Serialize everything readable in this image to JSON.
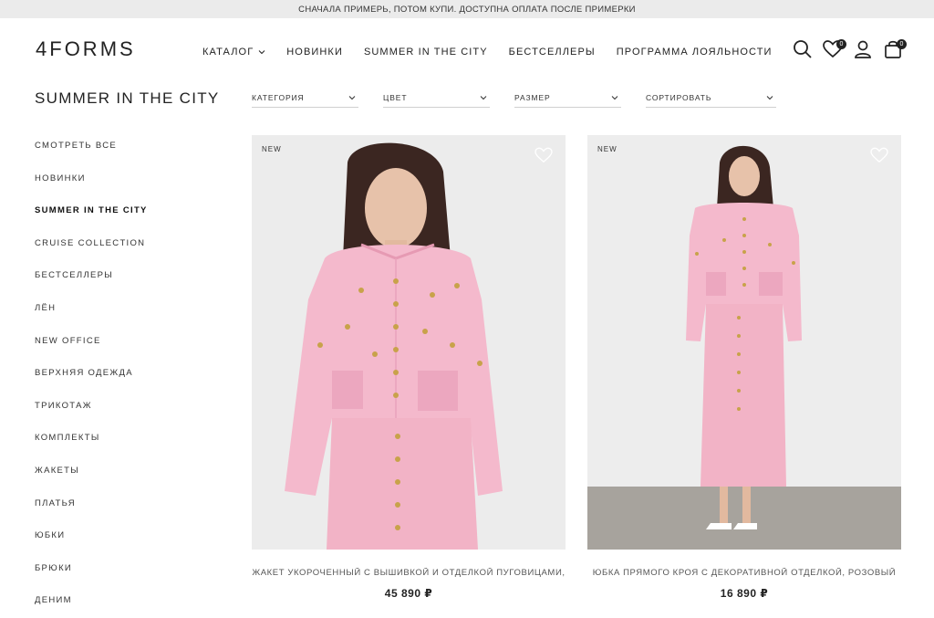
{
  "promo_bar": {
    "text": "СНАЧАЛА ПРИМЕРЬ, ПОТОМ КУПИ. ДОСТУПНА ОПЛАТА ПОСЛЕ ПРИМЕРКИ"
  },
  "header": {
    "logo": {
      "digit": "4",
      "word": "FORMS"
    },
    "nav": [
      {
        "label": "КАТАЛОГ",
        "has_dropdown": true
      },
      {
        "label": "НОВИНКИ"
      },
      {
        "label": "SUMMER IN THE CITY"
      },
      {
        "label": "БЕСТСЕЛЛЕРЫ"
      },
      {
        "label": "ПРОГРАММА ЛОЯЛЬНОСТИ"
      }
    ],
    "icons": {
      "search": "search-icon",
      "favorites": "heart-icon",
      "favorites_count": "0",
      "account": "user-icon",
      "cart": "bag-icon",
      "cart_count": "0"
    }
  },
  "page": {
    "title": "SUMMER IN THE CITY"
  },
  "filters": [
    {
      "label": "КАТЕГОРИЯ"
    },
    {
      "label": "ЦВЕТ"
    },
    {
      "label": "РАЗМЕР"
    },
    {
      "label": "СОРТИРОВАТЬ"
    }
  ],
  "sidebar": {
    "items": [
      {
        "label": "СМОТРЕТЬ ВСЕ"
      },
      {
        "label": "НОВИНКИ"
      },
      {
        "label": "SUMMER IN THE CITY",
        "active": true
      },
      {
        "label": "CRUISE COLLECTION"
      },
      {
        "label": "БЕСТСЕЛЛЕРЫ"
      },
      {
        "label": "ЛЁН"
      },
      {
        "label": "NEW OFFICE"
      },
      {
        "label": "ВЕРХНЯЯ ОДЕЖДА"
      },
      {
        "label": "ТРИКОТАЖ"
      },
      {
        "label": "КОМПЛЕКТЫ"
      },
      {
        "label": "ЖАКЕТЫ"
      },
      {
        "label": "ПЛАТЬЯ"
      },
      {
        "label": "ЮБКИ"
      },
      {
        "label": "БРЮКИ"
      },
      {
        "label": "ДЕНИМ"
      }
    ]
  },
  "products": [
    {
      "badge": "NEW",
      "name": "ЖАКЕТ УКОРОЧЕННЫЙ С ВЫШИВКОЙ И ОТДЕЛКОЙ ПУГОВИЦАМИ,",
      "price": "45 890 ₽"
    },
    {
      "badge": "NEW",
      "name": "ЮБКА ПРЯМОГО КРОЯ С ДЕКОРАТИВНОЙ ОТДЕЛКОЙ, РОЗОВЫЙ",
      "price": "16 890 ₽"
    }
  ],
  "colors": {
    "garment_pink": "#f4b9cc",
    "background": "#ececec",
    "text": "#222222"
  }
}
